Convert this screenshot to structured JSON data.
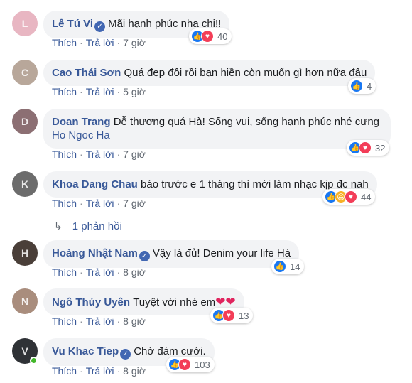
{
  "actions": {
    "like": "Thích",
    "reply": "Trả lời"
  },
  "comments": [
    {
      "author": "Lê Tú Vi",
      "verified": true,
      "text": "Mãi hạnh phúc nha chị!!",
      "reactions": [
        "like",
        "love"
      ],
      "count": "40",
      "time": "7 giờ",
      "avatar_color": "#e8b6c2"
    },
    {
      "author": "Cao Thái Sơn",
      "verified": false,
      "text": "Quá đẹp đôi rồi bạn hiền còn muốn gì hơn nữa đâu",
      "reactions": [
        "like"
      ],
      "count": "4",
      "time": "5 giờ",
      "avatar_color": "#b8a79a"
    },
    {
      "author": "Doan Trang",
      "verified": false,
      "text": "Dễ thương quá Hà! Sống vui, sống hạnh phúc nhé cưng",
      "mention": "Ho Ngoc Ha",
      "reactions": [
        "like",
        "love"
      ],
      "count": "32",
      "time": "7 giờ",
      "avatar_color": "#8c6f73"
    },
    {
      "author": "Khoa Dang Chau",
      "verified": false,
      "text": "báo trước e 1 tháng thì mới làm nhạc kịp đc nah",
      "reactions": [
        "like",
        "haha",
        "love"
      ],
      "count": "44",
      "time": "7 giờ",
      "avatar_color": "#6c6c6c",
      "replies": "1 phản hồi"
    },
    {
      "author": "Hoàng Nhật Nam",
      "verified": true,
      "text": "Vậy là đủ! Denim your life Hà",
      "reactions": [
        "like"
      ],
      "count": "14",
      "time": "8 giờ",
      "avatar_color": "#4a3f39"
    },
    {
      "author": "Ngô Thúy Uyên",
      "verified": false,
      "text": "Tuyệt vời nhé em",
      "reactions": [
        "like",
        "love"
      ],
      "count": "13",
      "time": "8 giờ",
      "avatar_color": "#a98d7d"
    },
    {
      "author": "Vu Khac Tiep",
      "verified": true,
      "text": "Chờ đám cưới.",
      "reactions": [
        "like",
        "love"
      ],
      "count": "103",
      "time": "8 giờ",
      "avatar_color": "#2f3236",
      "online": true
    }
  ]
}
